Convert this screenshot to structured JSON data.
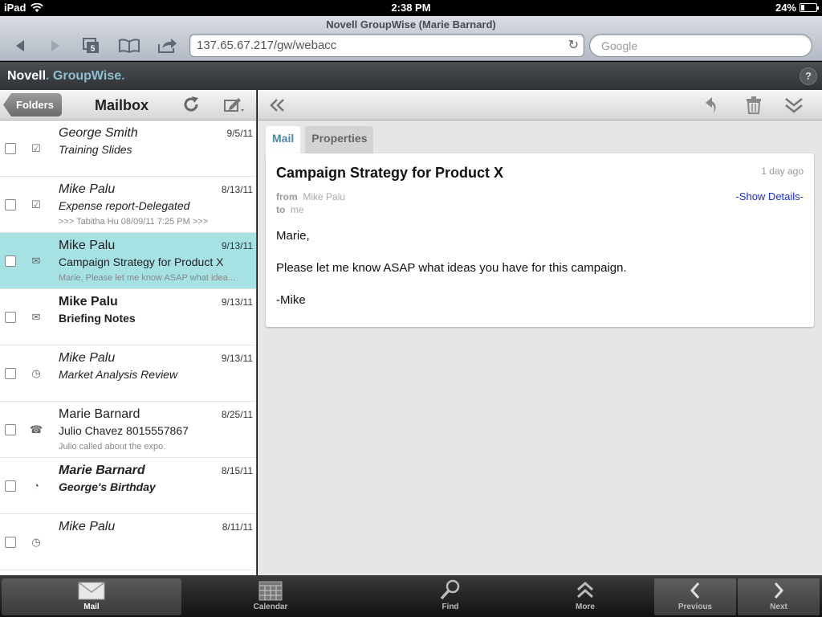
{
  "statusbar": {
    "device": "iPad",
    "time": "2:38 PM",
    "battery": "24%",
    "battery_level": 0.24
  },
  "safari": {
    "page_title": "Novell GroupWise (Marie Barnard)",
    "tabs_count": "5",
    "url": "137.65.67.217/gw/webacc",
    "search_placeholder": "Google"
  },
  "app": {
    "brand_novell": "Novell",
    "brand_groupwise": "GroupWise",
    "help": "?"
  },
  "mailbox": {
    "folders_label": "Folders",
    "title": "Mailbox",
    "messages": [
      {
        "from": "George Smith",
        "date": "9/5/11",
        "subject": "Training Slides",
        "preview": "",
        "icon": "task-check-icon"
      },
      {
        "from": "Mike Palu",
        "date": "8/13/11",
        "subject": "Expense report-Delegated",
        "preview": ">>> Tabitha Hu 08/09/11 7:25 PM >>>",
        "icon": "task-attachment-icon"
      },
      {
        "from": "Mike Palu",
        "date": "9/13/11",
        "subject": "Campaign Strategy for Product X",
        "preview": "Marie, Please let me know ASAP what idea...",
        "icon": "opened-mail-icon"
      },
      {
        "from": "Mike Palu",
        "date": "9/13/11",
        "subject": "Briefing Notes",
        "preview": "",
        "icon": "mail-icon"
      },
      {
        "from": "Mike Palu",
        "date": "9/13/11",
        "subject": "Market Analysis Review",
        "preview": "",
        "icon": "clock-icon"
      },
      {
        "from": "Marie Barnard",
        "date": "8/25/11",
        "subject": "Julio Chavez 8015557867",
        "preview": "Julio called about the expo.",
        "icon": "phone-icon"
      },
      {
        "from": "Marie Barnard",
        "date": "8/15/11",
        "subject": "George's Birthday",
        "preview": "",
        "icon": "clock-filled-icon"
      },
      {
        "from": "Mike Palu",
        "date": "8/11/11",
        "subject": "",
        "preview": "",
        "icon": "clock-icon"
      }
    ]
  },
  "reader": {
    "tabs": [
      "Mail",
      "Properties"
    ],
    "subject": "Campaign Strategy for Product X",
    "age": "1 day ago",
    "from_label": "from",
    "from": "Mike Palu",
    "to_label": "to",
    "to": "me",
    "show_details": "-Show Details-",
    "body": [
      "Marie,",
      "Please let me know ASAP what ideas you have for this campaign.",
      "-Mike"
    ]
  },
  "tabbar": {
    "mail": "Mail",
    "calendar": "Calendar",
    "find": "Find",
    "more": "More",
    "previous": "Previous",
    "next": "Next"
  }
}
